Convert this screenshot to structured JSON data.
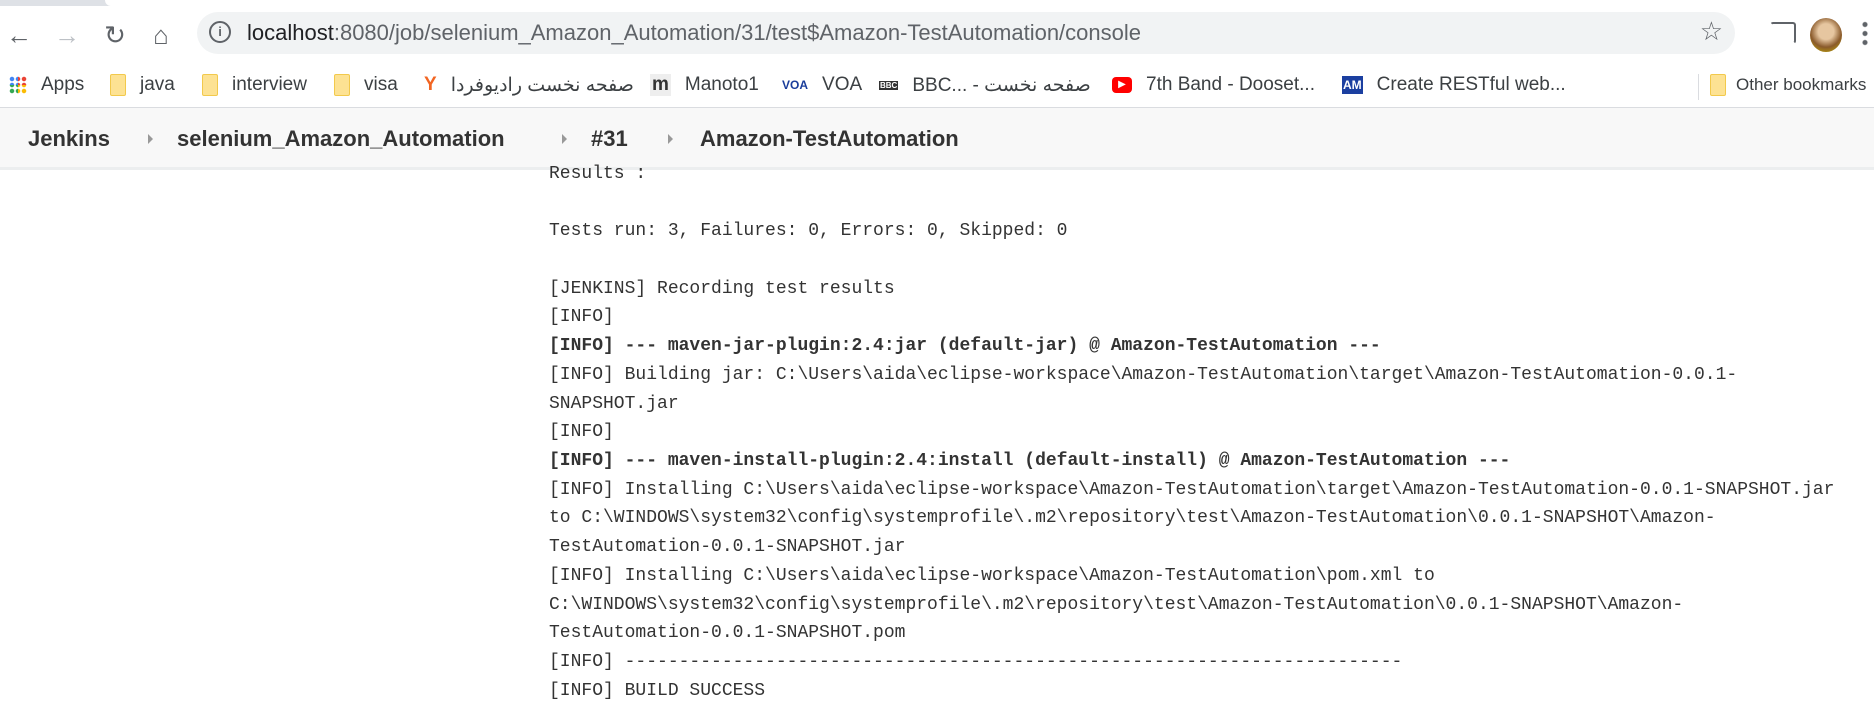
{
  "browser": {
    "url_host": "localhost",
    "url_rest": ":8080/job/selenium_Amazon_Automation/31/test$Amazon-TestAutomation/console",
    "bookmarks": [
      {
        "label": "Apps",
        "icon": "apps-grid-icon"
      },
      {
        "label": "java",
        "icon": "folder-icon"
      },
      {
        "label": "interview",
        "icon": "folder-icon"
      },
      {
        "label": "visa",
        "icon": "folder-icon"
      },
      {
        "label": "صفحه نخست راديوفردا",
        "icon": "radiofarda-icon"
      },
      {
        "label": "Manoto1",
        "icon": "manoto-icon"
      },
      {
        "label": "VOA",
        "icon": "voa-icon"
      },
      {
        "label": "BBC... - صفحه نخست",
        "icon": "bbc-icon"
      },
      {
        "label": "7th Band - Dooset...",
        "icon": "youtube-icon"
      },
      {
        "label": "Create RESTful web...",
        "icon": "am-icon"
      }
    ],
    "other_bookmarks": "Other bookmarks"
  },
  "breadcrumb": [
    "Jenkins",
    "selenium_Amazon_Automation",
    "#31",
    "Amazon-TestAutomation"
  ],
  "console": {
    "lines": [
      {
        "text": "Results :",
        "bold": false
      },
      {
        "text": "",
        "bold": false
      },
      {
        "text": "Tests run: 3, Failures: 0, Errors: 0, Skipped: 0",
        "bold": false
      },
      {
        "text": "",
        "bold": false
      },
      {
        "text": "[JENKINS] Recording test results",
        "bold": false
      },
      {
        "text": "[INFO]",
        "bold": false
      },
      {
        "text": "[INFO] --- maven-jar-plugin:2.4:jar (default-jar) @ Amazon-TestAutomation ---",
        "bold": true
      },
      {
        "text": "[INFO] Building jar: C:\\Users\\aida\\eclipse-workspace\\Amazon-TestAutomation\\target\\Amazon-TestAutomation-0.0.1-",
        "bold": false
      },
      {
        "text": "SNAPSHOT.jar",
        "bold": false
      },
      {
        "text": "[INFO]",
        "bold": false
      },
      {
        "text": "[INFO] --- maven-install-plugin:2.4:install (default-install) @ Amazon-TestAutomation ---",
        "bold": true
      },
      {
        "text": "[INFO] Installing C:\\Users\\aida\\eclipse-workspace\\Amazon-TestAutomation\\target\\Amazon-TestAutomation-0.0.1-SNAPSHOT.jar",
        "bold": false
      },
      {
        "text": "to C:\\WINDOWS\\system32\\config\\systemprofile\\.m2\\repository\\test\\Amazon-TestAutomation\\0.0.1-SNAPSHOT\\Amazon-",
        "bold": false
      },
      {
        "text": "TestAutomation-0.0.1-SNAPSHOT.jar",
        "bold": false
      },
      {
        "text": "[INFO] Installing C:\\Users\\aida\\eclipse-workspace\\Amazon-TestAutomation\\pom.xml to",
        "bold": false
      },
      {
        "text": "C:\\WINDOWS\\system32\\config\\systemprofile\\.m2\\repository\\test\\Amazon-TestAutomation\\0.0.1-SNAPSHOT\\Amazon-",
        "bold": false
      },
      {
        "text": "TestAutomation-0.0.1-SNAPSHOT.pom",
        "bold": false
      },
      {
        "text": "[INFO] ------------------------------------------------------------------------",
        "bold": false
      },
      {
        "text": "[INFO] BUILD SUCCESS",
        "bold": false
      }
    ]
  }
}
